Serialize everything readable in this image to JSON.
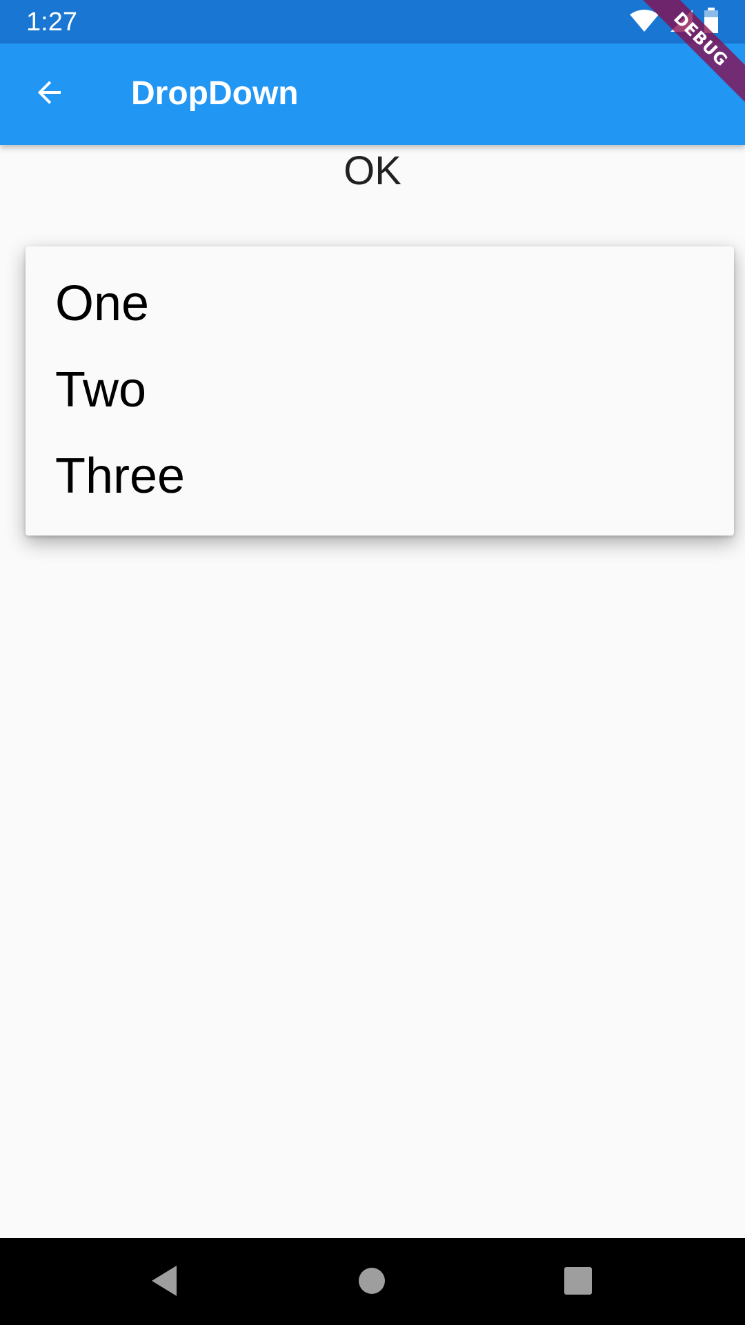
{
  "status_bar": {
    "time": "1:27",
    "background": "#1976d2",
    "icons": [
      "wifi-icon",
      "signal-icon",
      "battery-icon"
    ]
  },
  "app_bar": {
    "title": "DropDown",
    "background": "#2196f3",
    "back_icon": "arrow-back-icon"
  },
  "debug_banner": {
    "label": "DEBUG"
  },
  "content": {
    "selected_value": "OK"
  },
  "dropdown": {
    "items": [
      {
        "label": "One"
      },
      {
        "label": "Two"
      },
      {
        "label": "Three"
      }
    ]
  },
  "nav_bar": {
    "buttons": [
      "back-triangle-icon",
      "home-circle-icon",
      "recents-square-icon"
    ]
  }
}
